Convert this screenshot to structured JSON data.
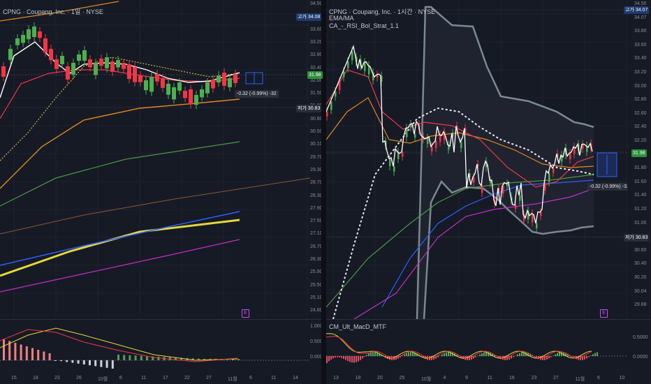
{
  "left": {
    "title": "CPNG · Coupang, Inc. · 1일 · NYSE",
    "axis": [
      "34.50",
      "34.08",
      "33.60",
      "33.20",
      "32.80",
      "32.40",
      "32.00",
      "31.50",
      "31.00",
      "30.80",
      "30.50",
      "30.10",
      "29.70",
      "29.30",
      "28.70",
      "28.30",
      "27.90",
      "27.50",
      "27.10",
      "26.70",
      "26.30",
      "25.90",
      "25.50",
      "25.10",
      "24.80"
    ],
    "high_tag_label": "고가",
    "high_tag_value": "34.08",
    "price_tag": "31.98",
    "low_tag_label": "저가",
    "low_tag_value": "30.83",
    "change": "-0.32 (-0.99%) -32",
    "earnings": "E",
    "macd_axis": [
      "1.0000",
      "0.5000",
      "0.0000"
    ],
    "dates": [
      "15",
      "18",
      "23",
      "26",
      "10월",
      "6",
      "11",
      "17",
      "22",
      "27",
      "11월",
      "6",
      "11",
      "14"
    ]
  },
  "right": {
    "title": "CPNG · Coupang, Inc. · 1시간 · NYSE",
    "ind1": "EMA/MA",
    "ind2": "CA_-_RSI_Bol_Strat_1.1",
    "axis": [
      "34.50",
      "34.07",
      "33.80",
      "33.60",
      "33.40",
      "33.20",
      "33.00",
      "32.80",
      "32.60",
      "32.40",
      "32.20",
      "32.00",
      "31.80",
      "31.60",
      "31.40",
      "31.20",
      "31.00",
      "30.83",
      "30.60",
      "30.40",
      "30.20",
      "30.04",
      "29.88"
    ],
    "high_tag_label": "고가",
    "high_tag_value": "34.07",
    "price_tag": "31.98",
    "low_tag_label": "저가",
    "low_tag_value": "30.83",
    "change": "-0.32 (-0.99%) -32",
    "earnings": "E",
    "macd_title": "CM_Ult_MacD_MTF",
    "macd_axis": [
      "0.5000",
      "0.0000"
    ],
    "dates": [
      "13",
      "18",
      "20",
      "25",
      "10월",
      "4",
      "9",
      "11",
      "16",
      "23",
      "27",
      "11월",
      "6",
      "10"
    ]
  },
  "colors": {
    "bg": "#161a25",
    "up": "#4caf50",
    "down": "#f23645",
    "white": "#ffffff",
    "yellow": "#e6d73a",
    "orange": "#e08a1e",
    "blue": "#2962ff",
    "magenta": "#c030c0",
    "green": "#4a9a44",
    "band": "#7a8a90"
  }
}
